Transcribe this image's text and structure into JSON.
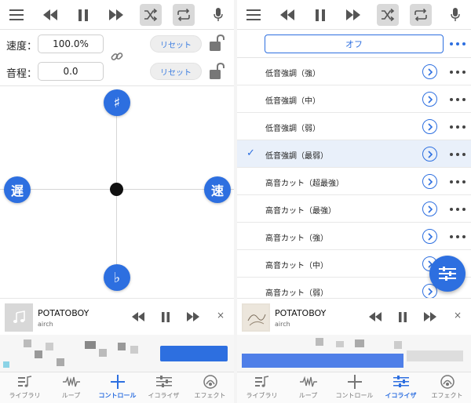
{
  "left": {
    "speed": {
      "label": "速度：",
      "value": "100.0%",
      "reset_label": "リセット"
    },
    "pitch": {
      "label": "音程：",
      "value": "0.0",
      "reset_label": "リセット"
    },
    "pad": {
      "top": "♯",
      "left": "遅",
      "right": "速",
      "bottom": "♭"
    },
    "now_playing": {
      "title": "POTATOBOY",
      "artist": "airch",
      "close": "×"
    },
    "tabs": [
      {
        "label": "ライブラリ",
        "icon": "library-icon",
        "active": false
      },
      {
        "label": "ループ",
        "icon": "waveform-icon",
        "active": false
      },
      {
        "label": "コントロール",
        "icon": "crosshair-icon",
        "active": true
      },
      {
        "label": "イコライザ",
        "icon": "equalizer-icon",
        "active": false
      },
      {
        "label": "エフェクト",
        "icon": "effect-icon",
        "active": false
      }
    ]
  },
  "right": {
    "off_label": "オフ",
    "presets": [
      {
        "label": "低音強調（強）",
        "selected": false
      },
      {
        "label": "低音強調（中）",
        "selected": false
      },
      {
        "label": "低音強調（弱）",
        "selected": false
      },
      {
        "label": "低音強調（最弱）",
        "selected": true
      },
      {
        "label": "高音カット（超最強）",
        "selected": false
      },
      {
        "label": "高音カット（最強）",
        "selected": false
      },
      {
        "label": "高音カット（強）",
        "selected": false
      },
      {
        "label": "高音カット（中）",
        "selected": false
      },
      {
        "label": "高音カット（弱）",
        "selected": false
      }
    ],
    "now_playing": {
      "title": "POTATOBOY",
      "artist": "airch",
      "close": "×"
    },
    "tabs": [
      {
        "label": "ライブラリ",
        "icon": "library-icon",
        "active": false
      },
      {
        "label": "ループ",
        "icon": "waveform-icon",
        "active": false
      },
      {
        "label": "コントロール",
        "icon": "crosshair-icon",
        "active": false
      },
      {
        "label": "イコライザ",
        "icon": "equalizer-icon",
        "active": true
      },
      {
        "label": "エフェクト",
        "icon": "effect-icon",
        "active": false
      }
    ]
  },
  "colors": {
    "accent": "#2d6fe0",
    "selected_row": "#e9f0fa",
    "toolbar_box": "#d9d9d9"
  }
}
